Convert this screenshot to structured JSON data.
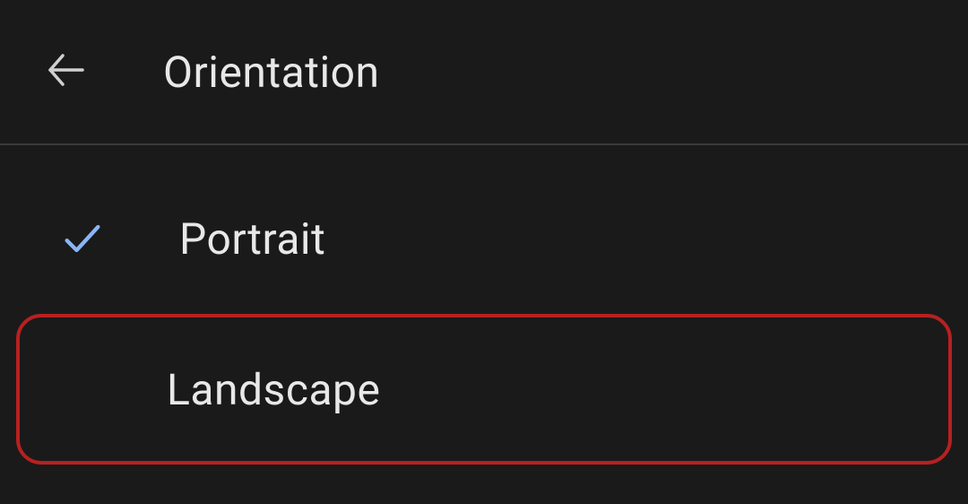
{
  "header": {
    "title": "Orientation"
  },
  "options": [
    {
      "label": "Portrait",
      "selected": true,
      "highlighted": false
    },
    {
      "label": "Landscape",
      "selected": false,
      "highlighted": true
    }
  ]
}
